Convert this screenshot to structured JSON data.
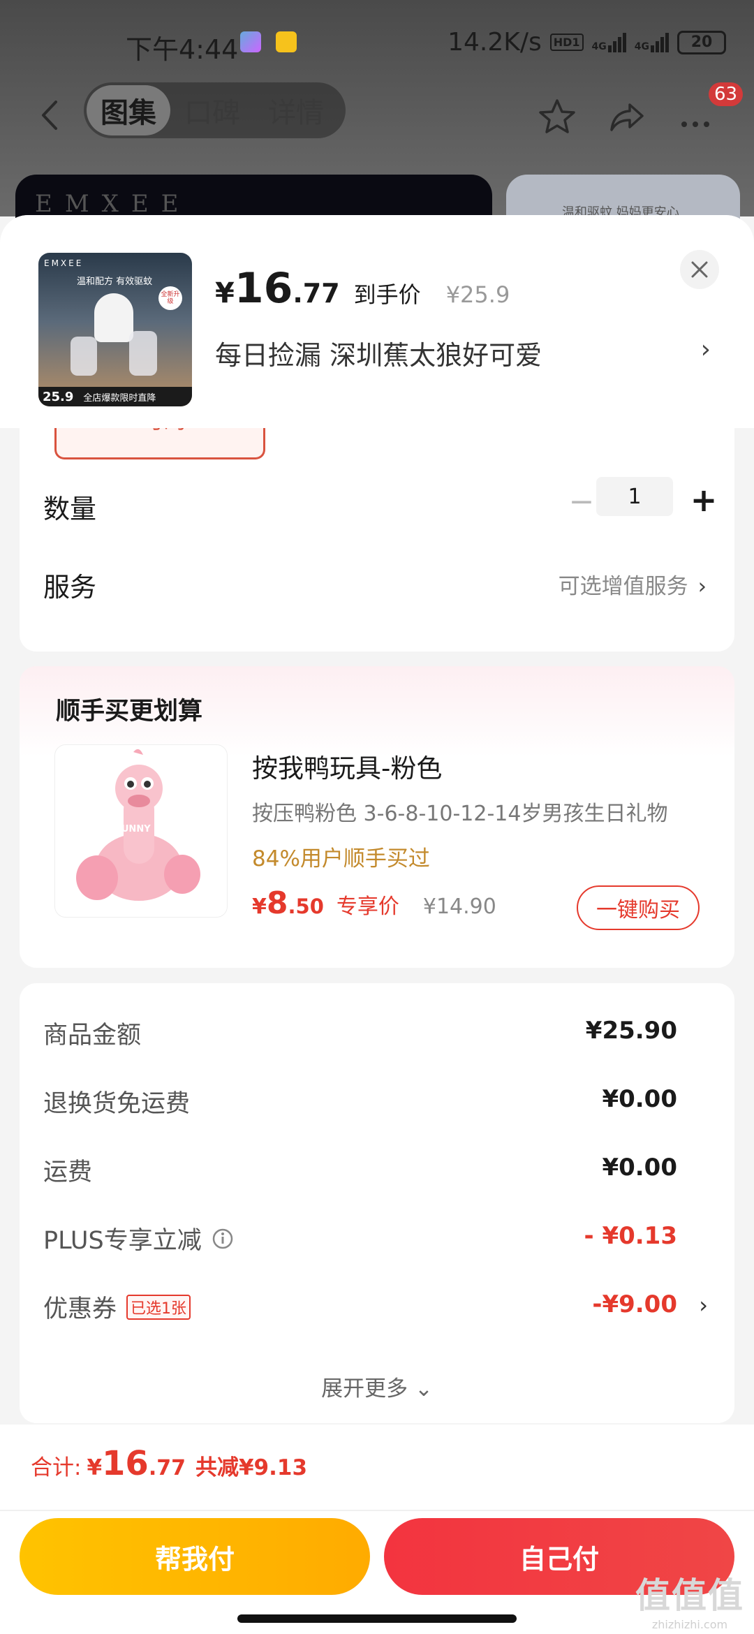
{
  "status_bar": {
    "time": "下午4:44",
    "net_speed": "14.2K/s",
    "hd_label": "HD1",
    "net_type_1": "4G",
    "net_type_2": "4G",
    "battery": "20"
  },
  "nav": {
    "tabs": [
      {
        "label": "图集",
        "active": true
      },
      {
        "label": "口碑",
        "active": false
      },
      {
        "label": "详情",
        "active": false
      }
    ],
    "notification_count": "63"
  },
  "background": {
    "brand_text": "EMXEE",
    "right_card_text": "温和驱蚊 妈妈更安心"
  },
  "product": {
    "thumb_brand": "EMXEE",
    "thumb_slogan": "温和配方 有效驱蚊",
    "thumb_tag": "全新升级",
    "thumb_price": "25.9",
    "thumb_strip_text": "全店爆款限时直降",
    "price_currency": "¥",
    "price_int": "16",
    "price_dec": ".77",
    "price_label": "到手价",
    "original_price": "¥25.9",
    "shop_text": "每日捡漏  深圳蕉太狼好可爱"
  },
  "options": {
    "size_chip": "均码",
    "quantity_label": "数量",
    "quantity_value": "1",
    "service_label": "服务",
    "service_value": "可选增值服务"
  },
  "addon": {
    "title": "顺手买更划算",
    "name": "按我鸭玩具-粉色",
    "desc": "按压鸭粉色   3-6-8-10-12-14岁男孩生日礼物",
    "social_proof": "84%用户顺手买过",
    "price_currency": "¥",
    "price_int": "8",
    "price_dec": ".50",
    "price_label": "专享价",
    "original_price": "¥14.90",
    "buy_button": "一键购买",
    "duck_text": "FUNNY"
  },
  "price_details": {
    "rows": [
      {
        "label": "商品金额",
        "value": "¥25.90"
      },
      {
        "label": "退换货免运费",
        "value": "¥0.00"
      },
      {
        "label": "运费",
        "value": "¥0.00"
      },
      {
        "label": "PLUS专享立减",
        "value": "- ¥0.13"
      },
      {
        "label": "优惠券",
        "tag": "已选1张",
        "value": "-¥9.00"
      }
    ],
    "expand_more": "展开更多"
  },
  "footer": {
    "total_label": "合计:",
    "total_currency": "¥",
    "total_int": "16",
    "total_dec": ".77",
    "saved": "共减¥9.13",
    "help_pay": "帮我付",
    "self_pay": "自己付"
  },
  "watermark": {
    "big": "值值值",
    "small": "zhizhizhi.com"
  },
  "colors": {
    "accent_red": "#e5392c",
    "help_button": "#ffb800",
    "self_button": "#f23c44",
    "social_gold": "#c38a2c"
  }
}
